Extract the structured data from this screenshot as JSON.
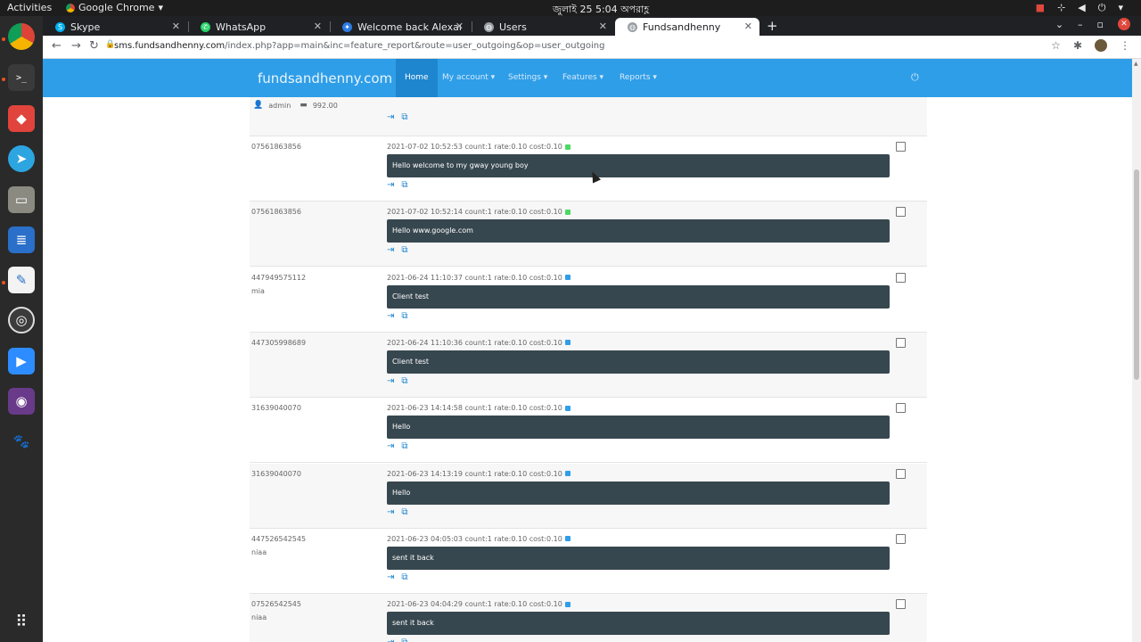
{
  "system": {
    "activities": "Activities",
    "app_menu": "Google Chrome",
    "clock": "জুলাই 25  5:04 অপরাহ্ণ"
  },
  "tabs": [
    {
      "label": "Skype",
      "color": "#00aff0"
    },
    {
      "label": "WhatsApp",
      "color": "#25d366"
    },
    {
      "label": "Welcome back Alexandru",
      "color": "#2c7be5"
    },
    {
      "label": "Users",
      "color": "#9aa0a6"
    },
    {
      "label": "Fundsandhenny",
      "color": "#9aa0a6"
    }
  ],
  "address": {
    "host": "sms.fundsandhenny.com",
    "path": "/index.php?app=main&inc=feature_report&route=user_outgoing&op=user_outgoing"
  },
  "site": {
    "brand": "fundsandhenny.com",
    "nav": {
      "home": "Home",
      "my_account": "My account ▾",
      "settings": "Settings ▾",
      "features": "Features ▾",
      "reports": "Reports ▾"
    },
    "accent_color": "#2f9ee8"
  },
  "user": {
    "name": "admin",
    "credit": "992.00"
  },
  "messages": [
    {
      "number": "07561863856",
      "name": "",
      "meta": "2021-07-02 10:52:53 count:1 rate:0.10 cost:0.10",
      "status_color": "#4cd964",
      "text": "Hello welcome to my gway young boy"
    },
    {
      "number": "07561863856",
      "name": "",
      "meta": "2021-07-02 10:52:14 count:1 rate:0.10 cost:0.10",
      "status_color": "#4cd964",
      "text": "Hello www.google.com"
    },
    {
      "number": "447949575112",
      "name": "mia",
      "meta": "2021-06-24 11:10:37 count:1 rate:0.10 cost:0.10",
      "status_color": "#2f9ee8",
      "text": "Client test"
    },
    {
      "number": "447305998689",
      "name": "",
      "meta": "2021-06-24 11:10:36 count:1 rate:0.10 cost:0.10",
      "status_color": "#2f9ee8",
      "text": "Client test"
    },
    {
      "number": "31639040070",
      "name": "",
      "meta": "2021-06-23 14:14:58 count:1 rate:0.10 cost:0.10",
      "status_color": "#2f9ee8",
      "text": "Hello"
    },
    {
      "number": "31639040070",
      "name": "",
      "meta": "2021-06-23 14:13:19 count:1 rate:0.10 cost:0.10",
      "status_color": "#2f9ee8",
      "text": "Hello"
    },
    {
      "number": "447526542545",
      "name": "niaa",
      "meta": "2021-06-23 04:05:03 count:1 rate:0.10 cost:0.10",
      "status_color": "#2f9ee8",
      "text": "sent it back"
    },
    {
      "number": "07526542545",
      "name": "niaa",
      "meta": "2021-06-23 04:04:29 count:1 rate:0.10 cost:0.10",
      "status_color": "#2f9ee8",
      "text": "sent it back"
    }
  ]
}
